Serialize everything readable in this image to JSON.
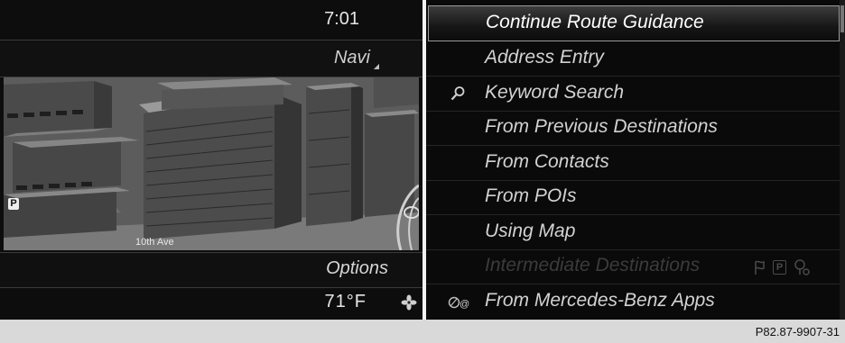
{
  "left": {
    "clock": "7:01",
    "navi_label": "Navi",
    "street_label": "10th Ave",
    "parking_badge": "P",
    "options_label": "Options",
    "temperature": "71°F"
  },
  "menu": {
    "items": [
      {
        "label": "Continue Route Guidance",
        "state": "selected",
        "icon": ""
      },
      {
        "label": "Address Entry",
        "state": "normal",
        "icon": ""
      },
      {
        "label": "Keyword Search",
        "state": "normal",
        "icon": "magnifier-icon"
      },
      {
        "label": "From Previous Destinations",
        "state": "normal",
        "icon": ""
      },
      {
        "label": "From Contacts",
        "state": "normal",
        "icon": ""
      },
      {
        "label": "From POIs",
        "state": "normal",
        "icon": ""
      },
      {
        "label": "Using Map",
        "state": "normal",
        "icon": ""
      },
      {
        "label": "Intermediate Destinations",
        "state": "disabled",
        "icon": "destination-icons"
      },
      {
        "label": "From Mercedes-Benz Apps",
        "state": "normal",
        "icon": "apps-icon"
      }
    ],
    "intermediate_badge": "P"
  },
  "caption": "P82.87-9907-31"
}
